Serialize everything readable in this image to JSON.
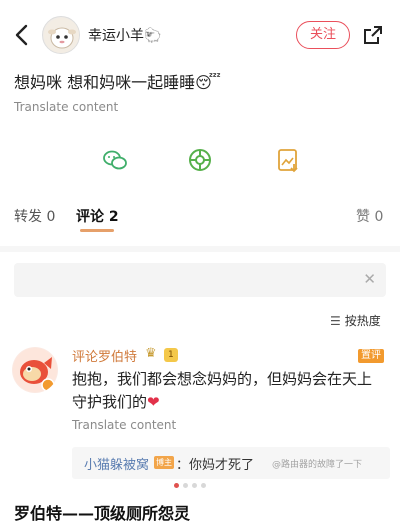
{
  "header": {
    "username": "幸运小羊",
    "username_emoji": "🐑",
    "follow_label": "关注",
    "icons": [
      "back-arrow-icon",
      "share-icon"
    ],
    "accent_color": "#ea4f5b"
  },
  "post": {
    "text": "想妈咪 想和妈咪一起睡睡",
    "text_emoji": "😴",
    "translate_label": "Translate content"
  },
  "actions": [
    {
      "name": "weixin-share-icon",
      "color": "#3fae6a"
    },
    {
      "name": "moments-share-icon",
      "color": "#56b04a"
    },
    {
      "name": "save-image-icon",
      "color": "#e0a43b"
    }
  ],
  "tabs": {
    "repost_label": "转发",
    "repost_count": "0",
    "comment_label": "评论",
    "comment_count": "2",
    "like_label": "赞",
    "like_count": "0"
  },
  "comment_input": {
    "placeholder": "",
    "close_icon": "close-icon"
  },
  "sort": {
    "label": "按热度"
  },
  "comment": {
    "author": "评论罗伯特",
    "level": "1",
    "top_badge": "置评",
    "text_line1": "抱抱，我们都会想念妈妈的，但妈妈会在天上",
    "text_line2": "守护我们的",
    "heart": "❤",
    "translate_label": "Translate content",
    "reply": {
      "author": "小猫躲被窝",
      "badge": "博主",
      "text": "：你妈才死了",
      "watermark": "@路由器的故障了一下"
    }
  },
  "pager": {
    "count": 4,
    "active": 0
  },
  "caption": "罗伯特——顶级厕所怨灵"
}
